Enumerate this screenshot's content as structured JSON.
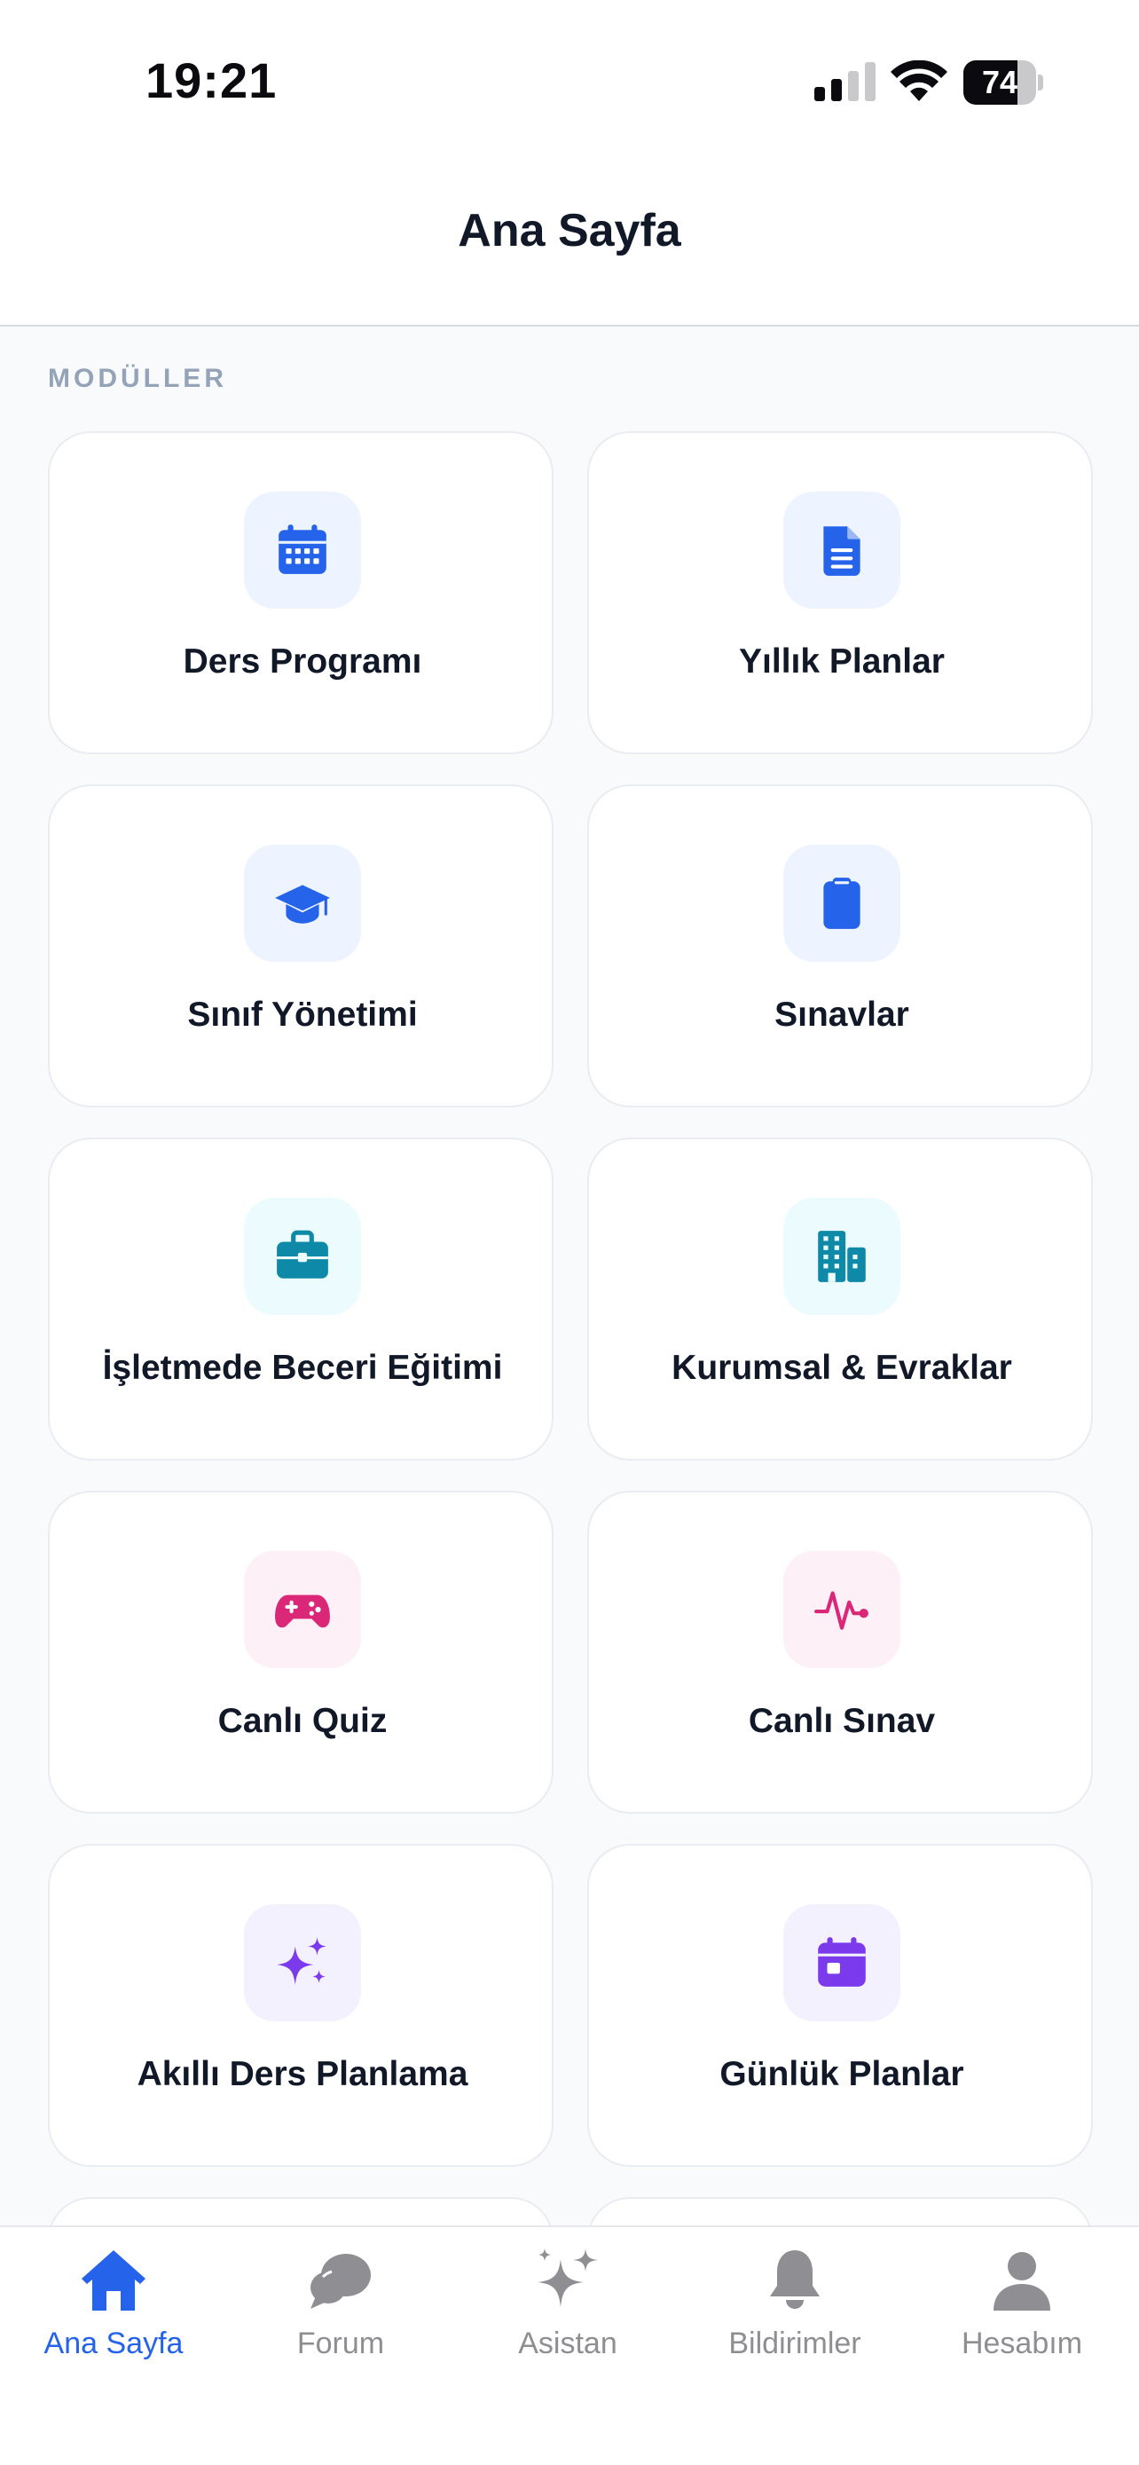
{
  "status_bar": {
    "time": "19:21",
    "battery_level": "74",
    "battery_fraction": 0.74
  },
  "header": {
    "title": "Ana Sayfa"
  },
  "modules": {
    "section_label": "MODÜLLER",
    "items": [
      {
        "label": "Ders Programı",
        "icon": "calendar-icon",
        "accent": "#2563eb",
        "tint": "#eef4ff"
      },
      {
        "label": "Yıllık Planlar",
        "icon": "document-icon",
        "accent": "#2563eb",
        "tint": "#eef4ff"
      },
      {
        "label": "Sınıf Yönetimi",
        "icon": "graduation-cap-icon",
        "accent": "#2563eb",
        "tint": "#eef4ff"
      },
      {
        "label": "Sınavlar",
        "icon": "clipboard-icon",
        "accent": "#2563eb",
        "tint": "#eef4ff"
      },
      {
        "label": "İşletmede Beceri Eğitimi",
        "icon": "briefcase-icon",
        "accent": "#0e8aa8",
        "tint": "#ecfbfe"
      },
      {
        "label": "Kurumsal & Evraklar",
        "icon": "building-icon",
        "accent": "#0e8aa8",
        "tint": "#ecfbfe"
      },
      {
        "label": "Canlı Quiz",
        "icon": "gamepad-icon",
        "accent": "#db2777",
        "tint": "#fdf0f6"
      },
      {
        "label": "Canlı Sınav",
        "icon": "pulse-icon",
        "accent": "#db2777",
        "tint": "#fdf0f6"
      },
      {
        "label": "Akıllı Ders Planlama",
        "icon": "sparkles-icon",
        "accent": "#7c3aed",
        "tint": "#f4f1fe"
      },
      {
        "label": "Günlük Planlar",
        "icon": "calendar-day-icon",
        "accent": "#7c3aed",
        "tint": "#f4f1fe"
      }
    ]
  },
  "tab_bar": {
    "active_color": "#2563eb",
    "inactive_color": "#8e8e93",
    "tabs": [
      {
        "label": "Ana Sayfa",
        "icon": "home-icon",
        "active": true
      },
      {
        "label": "Forum",
        "icon": "chat-bubbles-icon",
        "active": false
      },
      {
        "label": "Asistan",
        "icon": "sparkles-icon",
        "active": false
      },
      {
        "label": "Bildirimler",
        "icon": "bell-icon",
        "active": false
      },
      {
        "label": "Hesabım",
        "icon": "person-icon",
        "active": false
      }
    ]
  }
}
